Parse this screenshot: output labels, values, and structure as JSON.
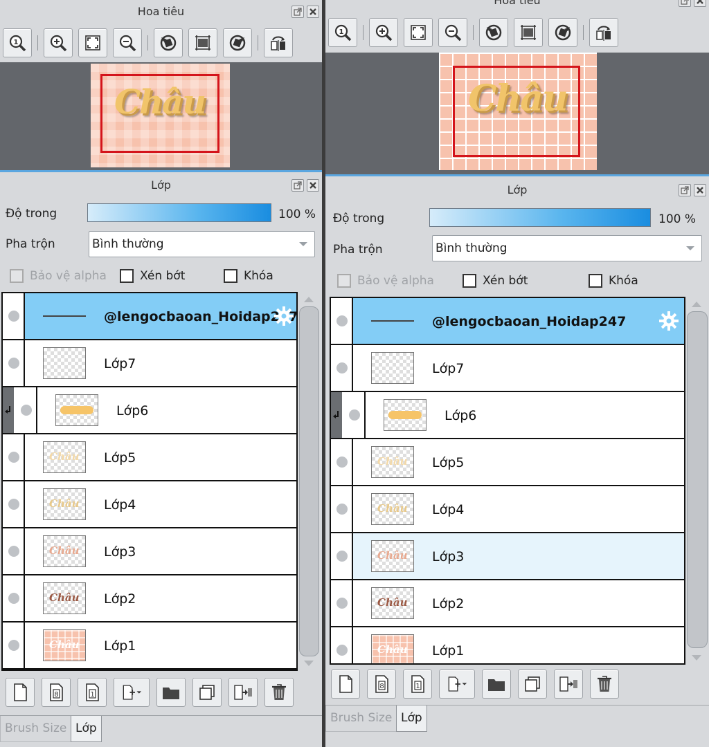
{
  "navigator": {
    "title": "Hoa tiêu",
    "logo": "Châu"
  },
  "layers_panel": {
    "title": "Lớp",
    "opacity_label": "Độ trong",
    "opacity_value": "100 %",
    "opacity": 1.0,
    "blend_label": "Pha trộn",
    "blend_value": "Bình thường",
    "protect_alpha": "Bảo vệ alpha",
    "clip": "Xén bớt",
    "lock": "Khóa"
  },
  "left_layers": [
    {
      "name": "@lengocbaoan_Hoidap247",
      "bold": true,
      "selected": true,
      "thumb": "line",
      "settings": true
    },
    {
      "name": "Lớp7",
      "thumb": "empty"
    },
    {
      "name": "Lớp6",
      "thumb": "bar",
      "clipped": true
    },
    {
      "name": "Lớp5",
      "thumb": "text",
      "thumb_text": "Châu",
      "thumb_color": "#f3d9a8"
    },
    {
      "name": "Lớp4",
      "thumb": "text",
      "thumb_text": "Châu",
      "thumb_color": "#e8c98a"
    },
    {
      "name": "Lớp3",
      "thumb": "text",
      "thumb_text": "Châu",
      "thumb_color": "#e8a98f"
    },
    {
      "name": "Lớp2",
      "thumb": "text",
      "thumb_text": "Châu",
      "thumb_color": "#9c5a45"
    },
    {
      "name": "Lớp1",
      "thumb": "pink",
      "thumb_text": "Châu",
      "thumb_color": "#ffffff"
    }
  ],
  "right_layers": [
    {
      "name": "@lengocbaoan_Hoidap247",
      "bold": true,
      "selected": true,
      "thumb": "line",
      "settings": true
    },
    {
      "name": "Lớp7",
      "thumb": "empty"
    },
    {
      "name": "Lớp6",
      "thumb": "bar",
      "clipped": true
    },
    {
      "name": "Lớp5",
      "thumb": "text",
      "thumb_text": "Châu",
      "thumb_color": "#f3d9a8"
    },
    {
      "name": "Lớp4",
      "thumb": "text",
      "thumb_text": "Châu",
      "thumb_color": "#e8c98a"
    },
    {
      "name": "Lớp3",
      "thumb": "text",
      "thumb_text": "Châu",
      "thumb_color": "#e8a98f",
      "hover": true
    },
    {
      "name": "Lớp2",
      "thumb": "text",
      "thumb_text": "Châu",
      "thumb_color": "#9c5a45"
    },
    {
      "name": "Lớp1",
      "thumb": "pink",
      "thumb_text": "Châu",
      "thumb_color": "#ffffff"
    }
  ],
  "tabs": [
    {
      "label": "Brush Size",
      "active": false
    },
    {
      "label": "Lớp",
      "active": true
    }
  ],
  "colors": {
    "selected_row": "#83cdf6",
    "frame": "#d4141b",
    "panel_bg": "#d7d9dc",
    "accent_bar": "#5aa6e0"
  }
}
